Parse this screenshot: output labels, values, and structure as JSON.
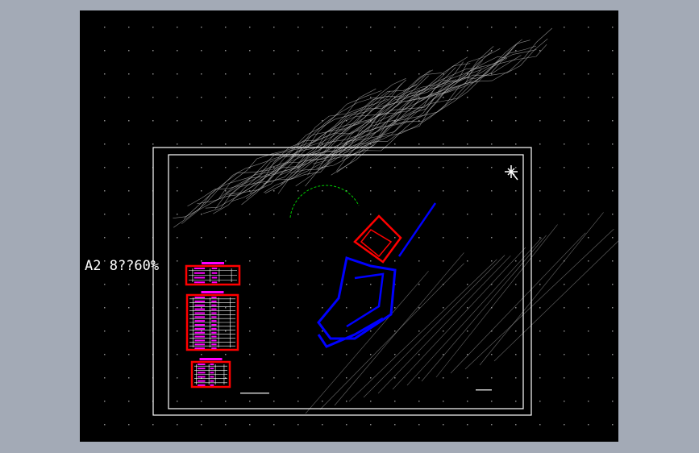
{
  "viewport": {
    "scale_label": "A2 8??60%",
    "colors": {
      "background": "#a3aab6",
      "canvas": "#000000",
      "frame": "#ffffff",
      "contour": "#bfbfbf",
      "table_border": "#ff0000",
      "table_text": "#ff00ff",
      "building_blue": "#0000ff",
      "building_red": "#ff0000",
      "arc_green": "#00cc00"
    },
    "icons": [
      "north-arrow-icon"
    ]
  }
}
